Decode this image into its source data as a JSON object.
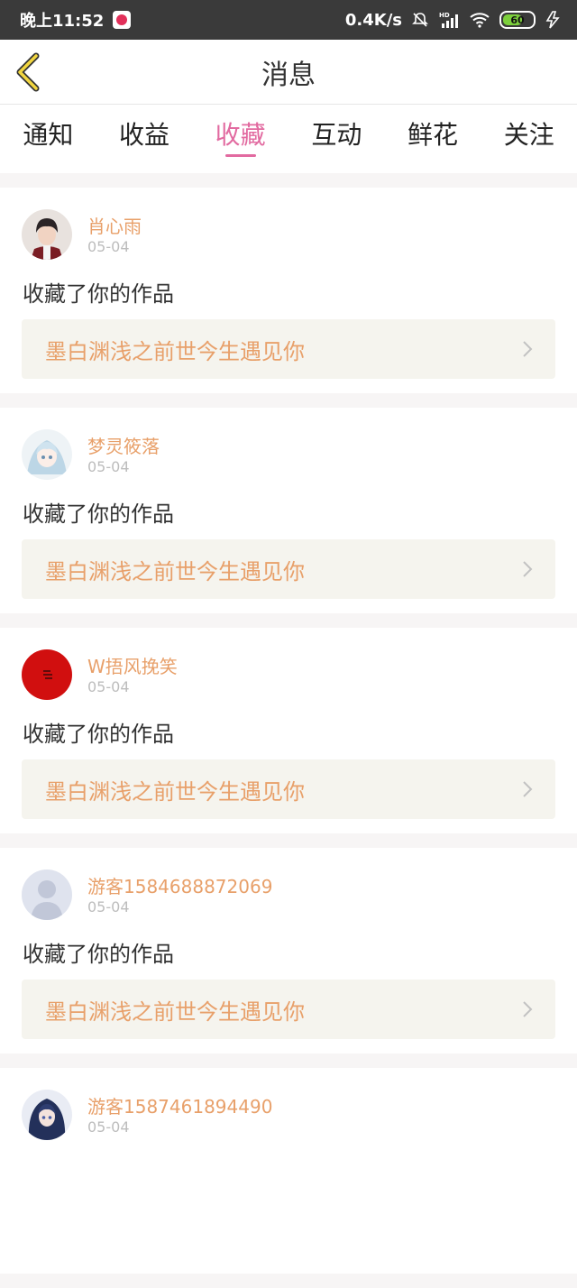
{
  "status_bar": {
    "time": "晚上11:52",
    "net_speed": "0.4K/s",
    "battery": "60"
  },
  "header": {
    "title": "消息"
  },
  "tabs": [
    {
      "label": "通知"
    },
    {
      "label": "收益"
    },
    {
      "label": "收藏"
    },
    {
      "label": "互动"
    },
    {
      "label": "鲜花"
    },
    {
      "label": "关注"
    }
  ],
  "active_tab": "收藏",
  "colors": {
    "accent": "#e26aa0",
    "name": "#e8a06a"
  },
  "messages": [
    {
      "user": "肖心雨",
      "date": "05-04",
      "action": "收藏了你的作品",
      "work": "墨白渊浅之前世今生遇见你"
    },
    {
      "user": "梦灵筱落",
      "date": "05-04",
      "action": "收藏了你的作品",
      "work": "墨白渊浅之前世今生遇见你"
    },
    {
      "user": "W捂风挽笑",
      "date": "05-04",
      "action": "收藏了你的作品",
      "work": "墨白渊浅之前世今生遇见你"
    },
    {
      "user": "游客1584688872069",
      "date": "05-04",
      "action": "收藏了你的作品",
      "work": "墨白渊浅之前世今生遇见你"
    },
    {
      "user": "游客1587461894490",
      "date": "05-04",
      "action": "",
      "work": ""
    }
  ]
}
